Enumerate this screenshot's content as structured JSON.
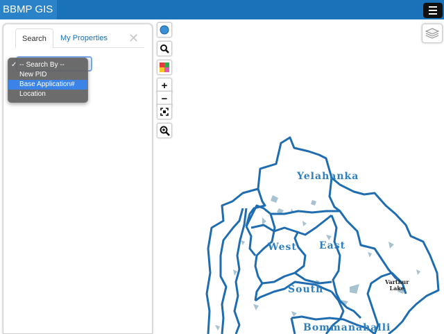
{
  "app": {
    "title": "BBMP GIS"
  },
  "tabs": [
    {
      "label": "Search",
      "active": true
    },
    {
      "label": "My Properties",
      "active": false
    }
  ],
  "search_by": {
    "options": [
      "-- Search By --",
      "New PID",
      "Base Application#",
      "Location"
    ],
    "checked_option": "-- Search By --",
    "highlighted_option": "Base Application#"
  },
  "map": {
    "labels": {
      "yelahanka": "Yelahanka",
      "west": "West",
      "east": "East",
      "south": "South",
      "bommanahalli": "Bommanahalli",
      "varthur_lake_1": "Varthur",
      "varthur_lake_2": "Lake"
    }
  },
  "toolbar": {
    "zoom_in": "+",
    "zoom_out": "−"
  },
  "colors": {
    "header": "#1a72b8",
    "boundary": "#1f6db0",
    "water": "#9ab8c8",
    "selection": "#3b83e6",
    "annotation_arrow": "#e53030"
  },
  "icons": [
    "hamburger-menu-icon",
    "close-icon",
    "location-dot-icon",
    "search-icon",
    "color-grid-icon",
    "zoom-in-icon",
    "zoom-out-icon",
    "full-extent-icon",
    "zoom-magnifier-icon",
    "layers-icon"
  ]
}
